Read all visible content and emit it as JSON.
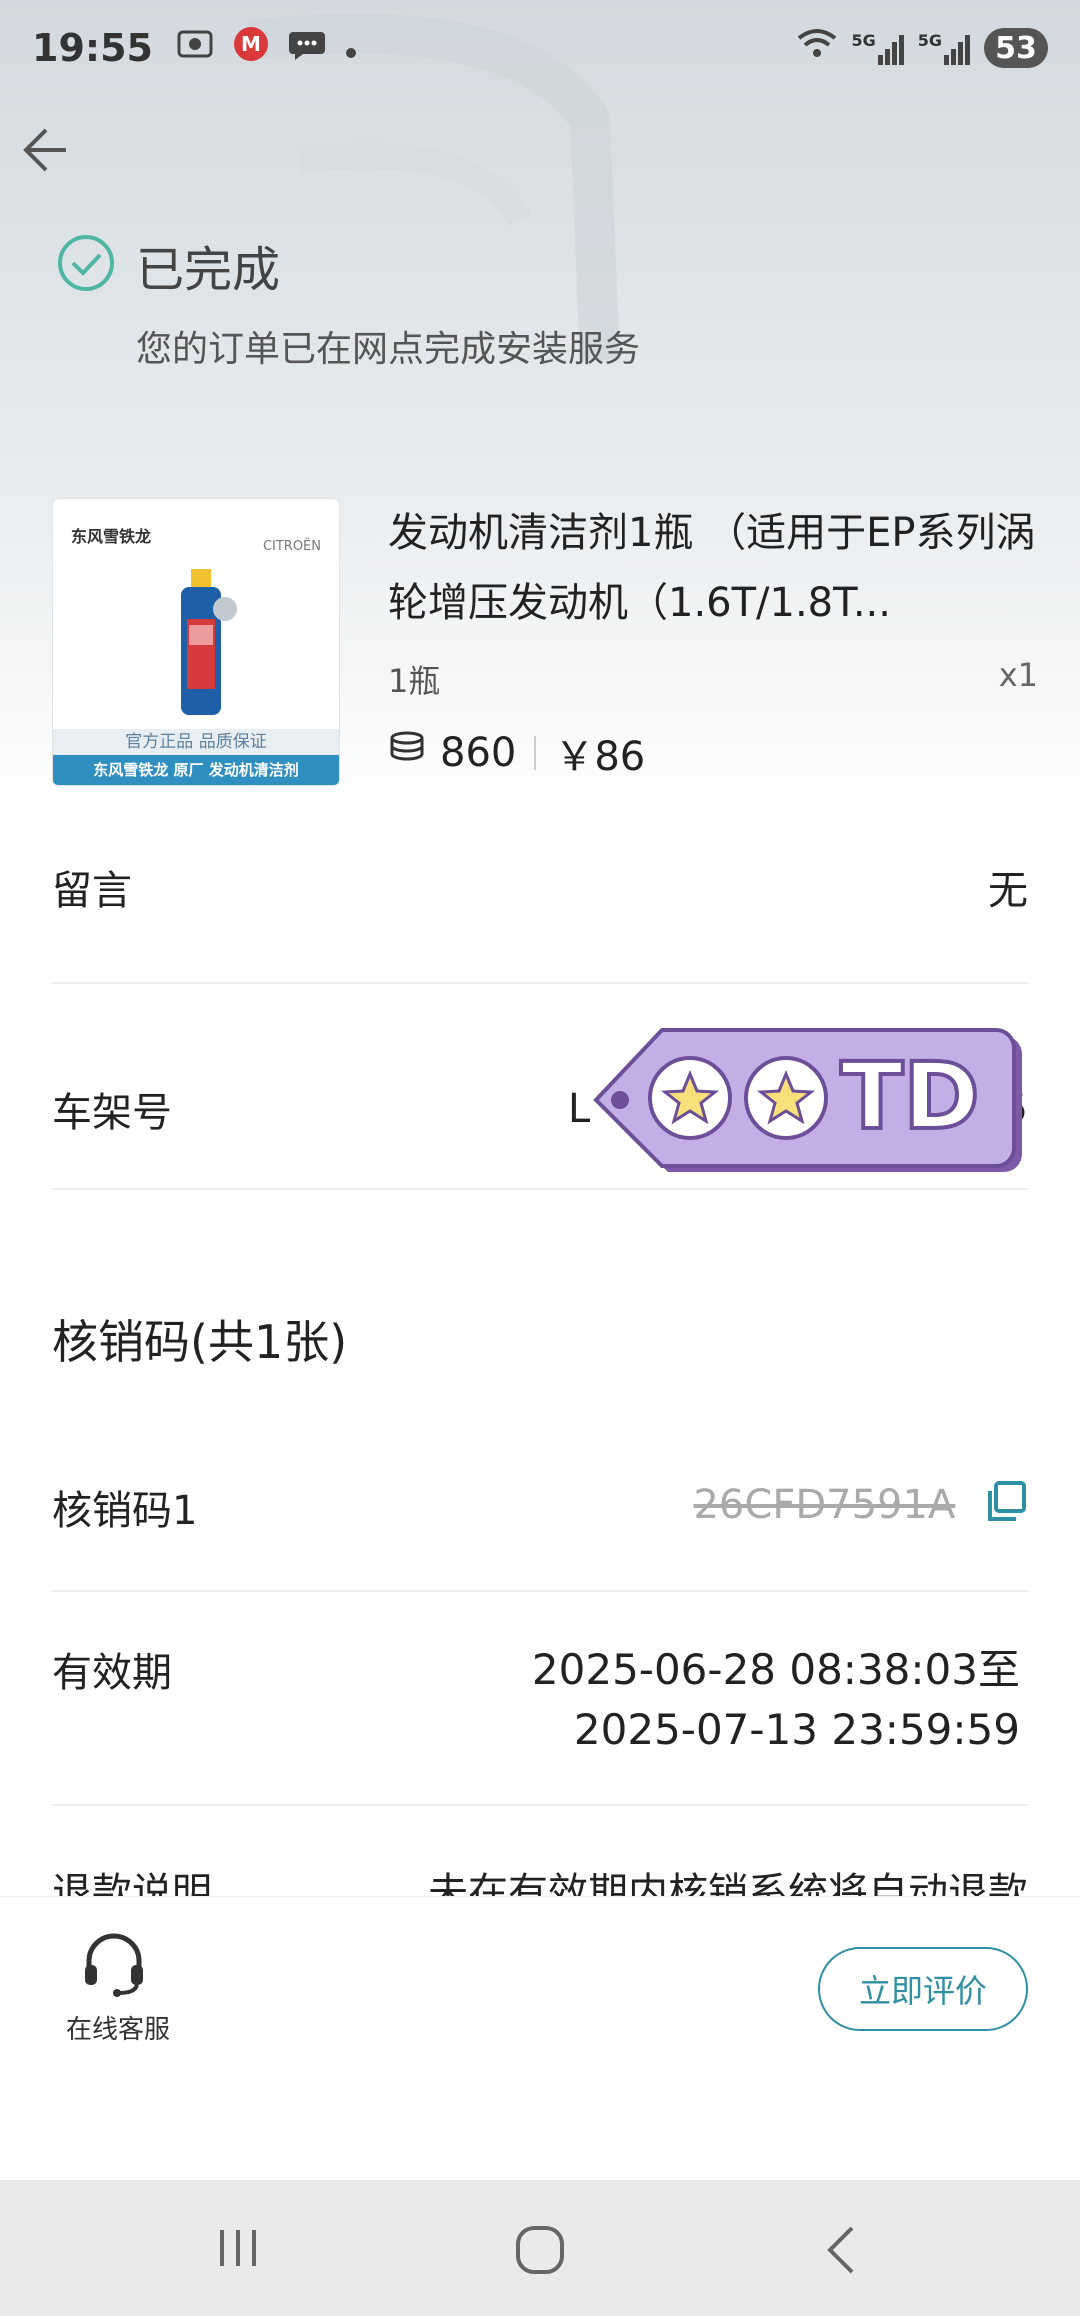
{
  "status_bar": {
    "time": "19:55",
    "battery": "53",
    "network_1": "5G",
    "network_2": "5G"
  },
  "order_status": {
    "title": "已完成",
    "subtitle": "您的订单已在网点完成安装服务"
  },
  "product": {
    "title": "发动机清洁剂1瓶 （适用于EP系列涡轮增压发动机（1.6T/1.8T...",
    "spec": "1瓶",
    "quantity": "x1",
    "points": "860",
    "price": "￥86",
    "image": {
      "brand_left": "东风雪铁龙",
      "brand_right": "CITROËN",
      "tag_1": "官方正品 品质保证",
      "tag_2": "东风雪铁龙 原厂 发动机清洁剂"
    }
  },
  "rows": {
    "message_label": "留言",
    "message_value": "无",
    "vin_label": "车架号",
    "vin_value_start": "L",
    "vin_value_end": "5"
  },
  "codes": {
    "section_title": "核销码(共1张)",
    "code_label": "核销码1",
    "code_value": "26CFD7591A",
    "validity_label": "有效期",
    "validity_line1": "2025-06-28 08:38:03至",
    "validity_line2": "2025-07-13 23:59:59",
    "refund_label": "退款说明",
    "refund_value": "未在有效期内核销系统将自动退款"
  },
  "sticker": {
    "text": "TD"
  },
  "bottom": {
    "customer_service": "在线客服",
    "review_button": "立即评价"
  },
  "colors": {
    "accent": "#2f8fa3",
    "check_green": "#4fb5a4",
    "sticker_purple": "#b49ad9"
  }
}
